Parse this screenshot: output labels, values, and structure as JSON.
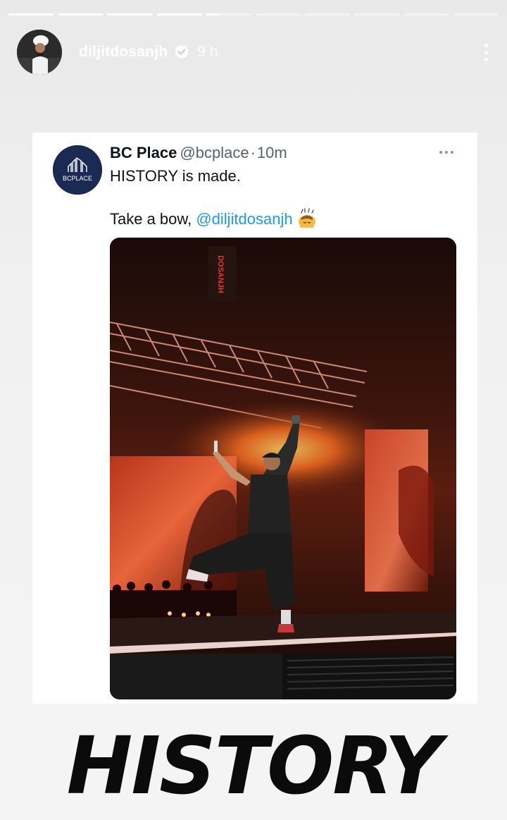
{
  "story": {
    "progress": {
      "segments": 10,
      "completed": 4,
      "current_fill": 0.3
    },
    "username": "diljitdosanjh",
    "verified": true,
    "age": "9 h",
    "icons": {
      "avatar": "profile-avatar",
      "verified": "verified-badge-icon",
      "more": "more-vertical-icon"
    }
  },
  "tweet": {
    "name": "BC Place",
    "handle": "@bcplace",
    "separator": "·",
    "time": "10m",
    "line1": "HISTORY is made.",
    "line2_prefix": "Take a bow, ",
    "mention": "@diljitdosanjh",
    "logo_text": "BCPLACE",
    "emoji": "bowing-face-emoji",
    "more_icon": "more-horizontal-icon",
    "stage_text": "DOSANJH"
  },
  "caption": "HISTORY",
  "colors": {
    "mention": "#1d9bf0",
    "verified_badge": "#ffffff",
    "logo_bg": "#1b2a52"
  }
}
